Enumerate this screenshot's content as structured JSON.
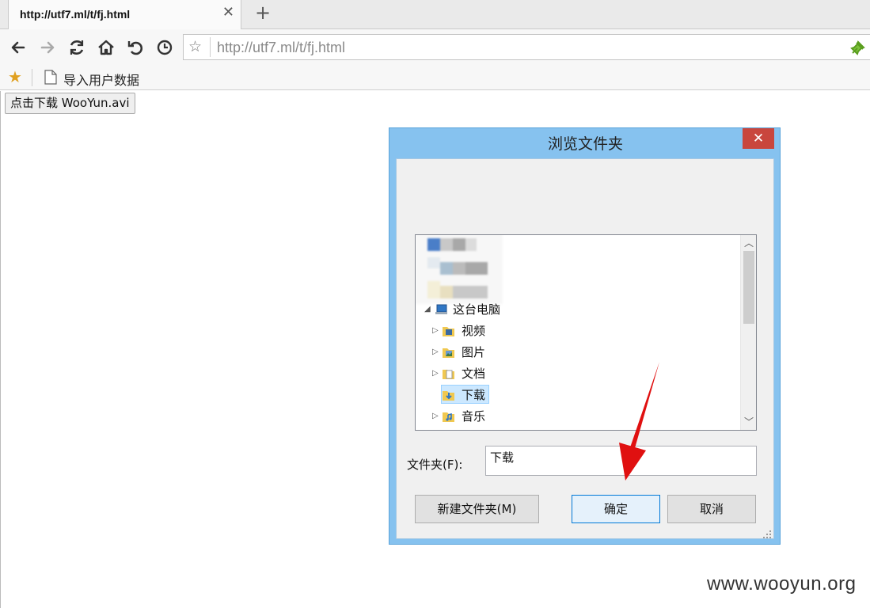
{
  "browser": {
    "tab_title": "http://utf7.ml/t/fj.html",
    "tab_close": "✕",
    "new_tab": "+",
    "url": "http://utf7.ml/t/fj.html",
    "url_star": "☆",
    "bookmark_star": "★",
    "bookmark_label": "导入用户数据"
  },
  "page": {
    "download_button": "点击下载 WooYun.avi"
  },
  "dialog": {
    "title": "浏览文件夹",
    "close": "✕",
    "tree": {
      "computer": "这台电脑",
      "items": [
        "视频",
        "图片",
        "文档",
        "下载",
        "音乐"
      ],
      "selected": "下载"
    },
    "folder_label": "文件夹(F):",
    "folder_value": "下载",
    "new_folder_button": "新建文件夹(M)",
    "ok_button": "确定",
    "cancel_button": "取消"
  },
  "watermark": "www.wooyun.org",
  "colors": {
    "dialog_frame": "#86c2ef",
    "close_button": "#c9463d",
    "selection": "#cce8ff",
    "arrow": "#e01010"
  }
}
